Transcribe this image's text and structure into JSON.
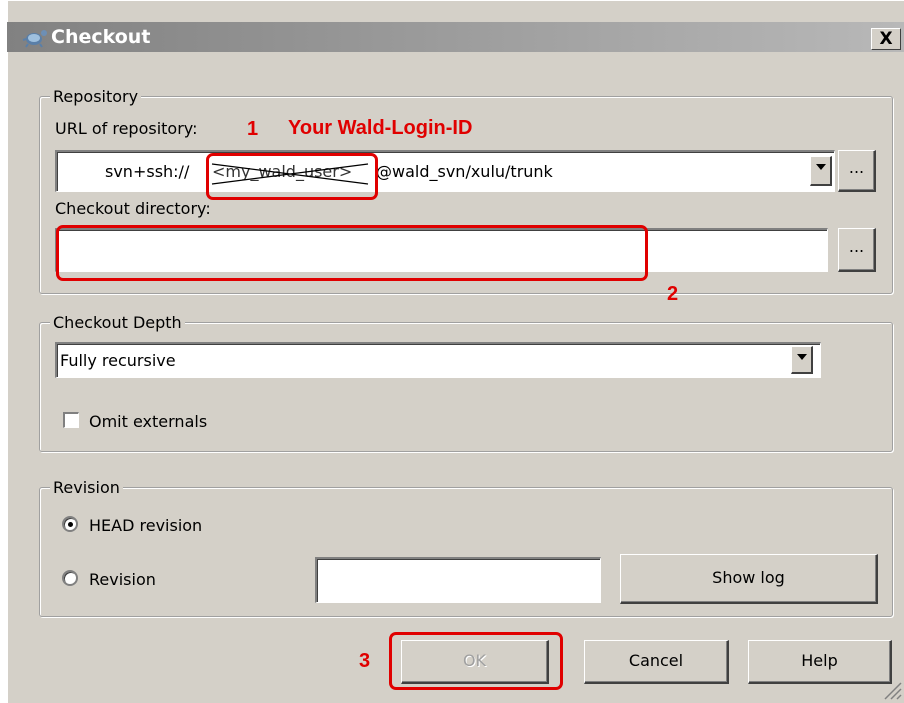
{
  "window": {
    "title": "Checkout",
    "close_label": "X"
  },
  "repository": {
    "legend": "Repository",
    "url_label": "URL of repository:",
    "url_prefix": "svn+ssh://",
    "url_user": "<my_wald_user>",
    "url_suffix": "@wald_svn/xulu/trunk",
    "url_browse": "...",
    "dir_label": "Checkout directory:",
    "dir_value": "",
    "dir_browse": "..."
  },
  "depth": {
    "legend": "Checkout Depth",
    "selected": "Fully recursive",
    "omit_externals_label": "Omit externals",
    "omit_externals_checked": false
  },
  "revision": {
    "legend": "Revision",
    "head_label": "HEAD revision",
    "revision_label": "Revision",
    "revision_value": "",
    "show_log": "Show log",
    "selected": "HEAD revision"
  },
  "buttons": {
    "ok": "OK",
    "cancel": "Cancel",
    "help": "Help"
  },
  "annotations": {
    "one": "1",
    "one_text": "Your Wald-Login-ID",
    "two": "2",
    "three": "3",
    "color": "#e00000"
  },
  "icons": {
    "title": "tortoise-icon",
    "dropdown": "chevron-down-icon"
  }
}
